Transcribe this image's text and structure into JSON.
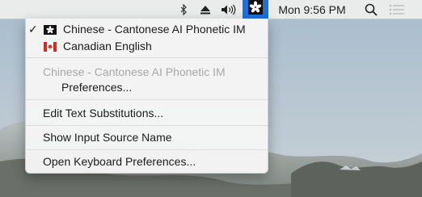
{
  "menubar": {
    "clock": "Mon 9:56 PM",
    "icons": [
      "bluetooth-icon",
      "eject-icon",
      "volume-icon",
      "hong-kong-flag-icon",
      "search-icon",
      "notification-center-icon"
    ]
  },
  "menu": {
    "sources": [
      {
        "label": "Chinese - Cantonese AI Phonetic IM",
        "selected": true,
        "flag": "hong-kong"
      },
      {
        "label": "Canadian English",
        "selected": false,
        "flag": "canada"
      }
    ],
    "section_heading": "Chinese - Cantonese AI Phonetic IM",
    "preferences": "Preferences...",
    "edit_text_substitutions": "Edit Text Substitutions...",
    "show_input_source_name": "Show Input Source Name",
    "open_keyboard_preferences": "Open Keyboard Preferences..."
  },
  "colors": {
    "highlight": "#1f6fd6",
    "disabled_text": "#a8a8a8"
  }
}
